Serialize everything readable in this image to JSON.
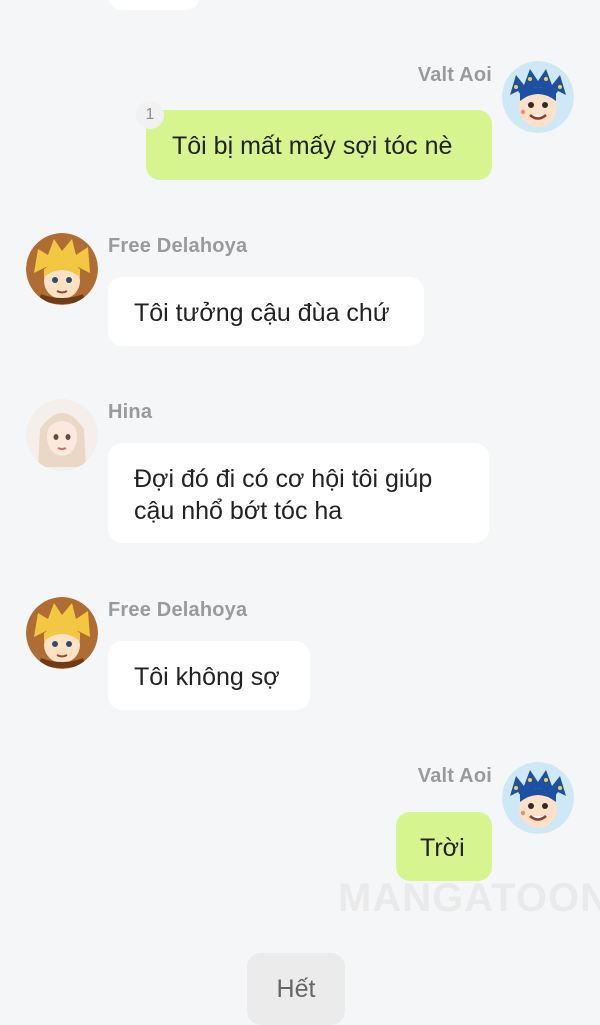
{
  "messages": [
    {
      "sender": "Valt Aoi",
      "side": "right",
      "text": "Tôi bị mất mấy sợi tóc nè",
      "badge": "1",
      "avatar_icon": "valt-aoi-avatar-icon"
    },
    {
      "sender": "Free Delahoya",
      "side": "left",
      "text": "Tôi tưởng cậu đùa chứ",
      "avatar_icon": "free-delahoya-avatar-icon"
    },
    {
      "sender": "Hina",
      "side": "left",
      "line1": "Đợi đó đi có cơ hội tôi giúp",
      "line2": "cậu nhổ bớt tóc ha",
      "avatar_icon": "hina-avatar-icon"
    },
    {
      "sender": "Free Delahoya",
      "side": "left",
      "text": "Tôi không sợ",
      "avatar_icon": "free-delahoya-avatar-icon"
    },
    {
      "sender": "Valt Aoi",
      "side": "right",
      "text": "Trời",
      "avatar_icon": "valt-aoi-avatar-icon"
    }
  ],
  "watermark": "MANGATOON",
  "end_button_label": "Hết",
  "colors": {
    "background": "#f5f6f8",
    "left_bubble": "#ffffff",
    "right_bubble": "#d6f58f",
    "name_text": "#9a9a9a"
  }
}
